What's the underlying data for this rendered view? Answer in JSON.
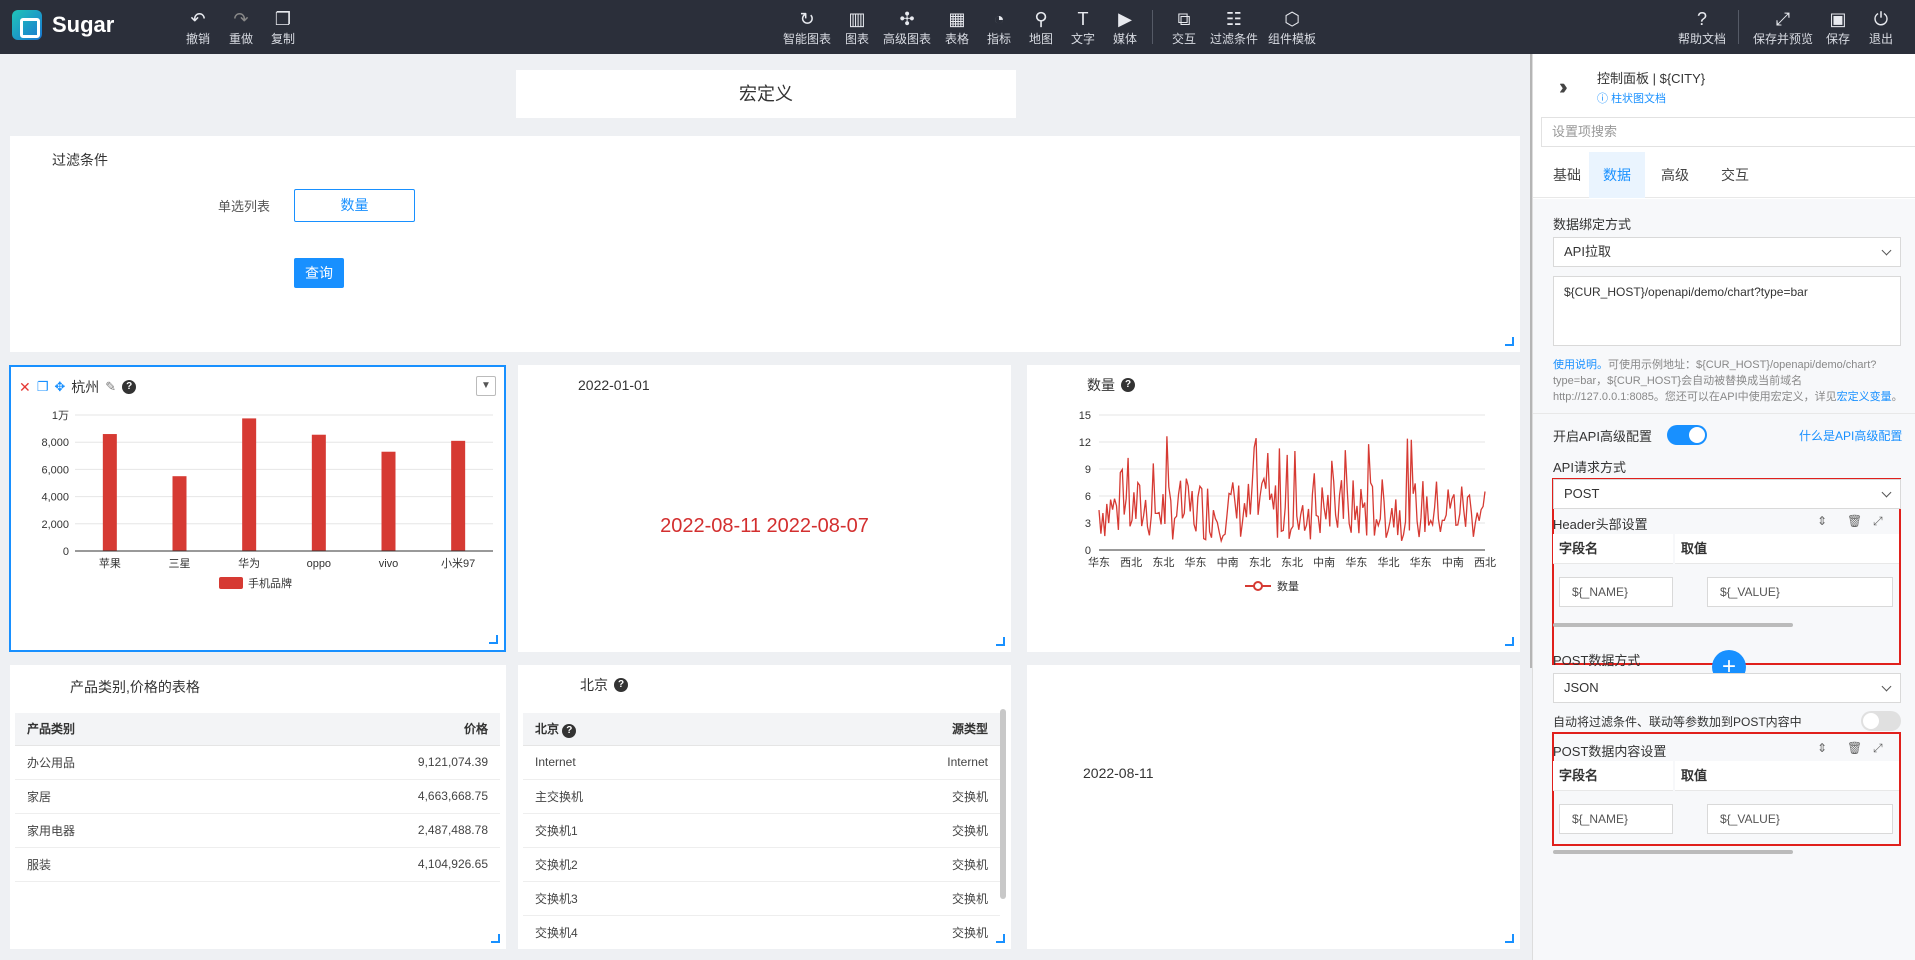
{
  "app": {
    "name": "Sugar"
  },
  "toolbar": {
    "left": [
      {
        "label": "撤销",
        "icon": "undo-icon"
      },
      {
        "label": "重做",
        "icon": "redo-icon"
      },
      {
        "label": "复制",
        "icon": "copy-icon"
      }
    ],
    "center": [
      {
        "label": "智能图表",
        "icon": "smart-chart-icon"
      },
      {
        "label": "图表",
        "icon": "chart-icon"
      },
      {
        "label": "高级图表",
        "icon": "advanced-chart-icon"
      },
      {
        "label": "表格",
        "icon": "table-icon"
      },
      {
        "label": "指标",
        "icon": "gauge-icon"
      },
      {
        "label": "地图",
        "icon": "map-icon"
      },
      {
        "label": "文字",
        "icon": "text-icon"
      },
      {
        "label": "媒体",
        "icon": "media-icon"
      },
      {
        "label": "交互",
        "icon": "interaction-icon"
      },
      {
        "label": "过滤条件",
        "icon": "filter-icon"
      },
      {
        "label": "组件模板",
        "icon": "template-icon"
      }
    ],
    "right": [
      {
        "label": "帮助文档",
        "icon": "help-icon"
      },
      {
        "label": "保存并预览",
        "icon": "expand-icon"
      },
      {
        "label": "保存",
        "icon": "save-icon"
      },
      {
        "label": "退出",
        "icon": "exit-icon"
      }
    ]
  },
  "canvas": {
    "macro_title": "宏定义",
    "filter": {
      "title": "过滤条件",
      "label": "单选列表",
      "value": "数量",
      "query_button": "查询"
    },
    "bar_chart": {
      "title": "杭州"
    },
    "date_panel": {
      "title": "2022-01-01",
      "dates": "2022-08-11 2022-08-07"
    },
    "line_chart": {
      "title": "数量"
    },
    "price_table": {
      "title": "产品类别,价格的表格",
      "headers": [
        "产品类别",
        "价格"
      ],
      "rows": [
        [
          "办公用品",
          "9,121,074.39"
        ],
        [
          "家居",
          "4,663,668.75"
        ],
        [
          "家用电器",
          "2,487,488.78"
        ],
        [
          "服装",
          "4,104,926.65"
        ]
      ]
    },
    "beijing_table": {
      "title": "北京",
      "headers": [
        "北京",
        "源类型"
      ],
      "rows": [
        [
          "Internet",
          "Internet"
        ],
        [
          "主交换机",
          "交换机"
        ],
        [
          "交换机1",
          "交换机"
        ],
        [
          "交换机2",
          "交换机"
        ],
        [
          "交换机3",
          "交换机"
        ],
        [
          "交换机4",
          "交换机"
        ]
      ]
    },
    "single_date": "2022-08-11"
  },
  "chart_data": [
    {
      "type": "bar",
      "categories": [
        "苹果",
        "三星",
        "华为",
        "oppo",
        "vivo",
        "小米97"
      ],
      "series": [
        {
          "name": "手机品牌",
          "values": [
            8600,
            5500,
            9750,
            8550,
            7300,
            8100
          ]
        }
      ],
      "yticks": [
        "0",
        "2,000",
        "4,000",
        "6,000",
        "8,000",
        "1万"
      ],
      "ylim": [
        0,
        10000
      ],
      "color": "#d63a33"
    },
    {
      "type": "line",
      "xticks": [
        "华东",
        "西北",
        "东北",
        "华东",
        "中南",
        "东北",
        "东北",
        "中南",
        "华东",
        "华北",
        "华东",
        "中南",
        "西北"
      ],
      "yticks": [
        "0",
        "3",
        "6",
        "9",
        "12",
        "15"
      ],
      "ylim": [
        0,
        15
      ],
      "series": [
        {
          "name": "数量",
          "points": 200
        }
      ],
      "color": "#d63a33"
    }
  ],
  "control_panel": {
    "title": "控制面板 | ${CITY}",
    "doc_link": "柱状图文档",
    "search_placeholder": "设置项搜索",
    "tabs": [
      "基础",
      "数据",
      "高级",
      "交互"
    ],
    "active_tab": "数据",
    "binding_label": "数据绑定方式",
    "binding_value": "API拉取",
    "api_url": "${CUR_HOST}/openapi/demo/chart?type=bar",
    "hint_link": "使用说明。",
    "hint_text": "可使用示例地址：${CUR_HOST}/openapi/demo/chart?type=bar，${CUR_HOST}会自动被替换成当前域名http://127.0.0.1:8085。您还可以在API中使用宏定义，详见",
    "hint_link2": "宏定义变量",
    "hint_end": "。",
    "advanced_label": "开启API高级配置",
    "advanced_link": "什么是API高级配置",
    "method_label": "API请求方式",
    "method_value": "POST",
    "header_label": "Header头部设置",
    "kv_headers": [
      "字段名",
      "取值"
    ],
    "kv_name": "${_NAME}",
    "kv_value": "${_VALUE}",
    "post_mode_label": "POST数据方式",
    "post_mode_value": "JSON",
    "auto_label": "自动将过滤条件、联动等参数加到POST内容中",
    "post_content_label": "POST数据内容设置"
  }
}
